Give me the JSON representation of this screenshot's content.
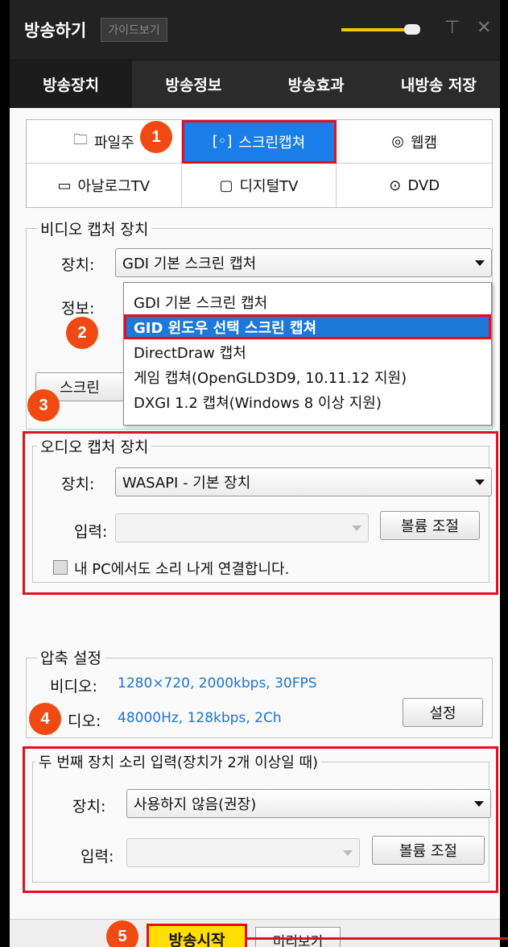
{
  "titlebar": {
    "title": "방송하기",
    "guide_label": "가이드보기",
    "pin_icon": "pin-icon",
    "close_icon": "close-icon"
  },
  "tabs": [
    {
      "label": "방송장치"
    },
    {
      "label": "방송정보"
    },
    {
      "label": "방송효과"
    },
    {
      "label": "내방송 저장"
    }
  ],
  "sources": [
    {
      "label": "파일주",
      "icon": "folder-icon",
      "selected": false
    },
    {
      "label": "스크린캡쳐",
      "icon": "screen-capture-icon",
      "selected": true
    },
    {
      "label": "웹캠",
      "icon": "webcam-icon",
      "selected": false
    },
    {
      "label": "아날로그TV",
      "icon": "analog-tv-icon",
      "selected": false
    },
    {
      "label": "디지털TV",
      "icon": "digital-tv-icon",
      "selected": false
    },
    {
      "label": "DVD",
      "icon": "dvd-icon",
      "selected": false
    }
  ],
  "video_capture": {
    "legend": "비디오 캡처 장치",
    "device_label": "장치:",
    "device_value": "GDI 기본 스크린 캡처",
    "info_label": "정보:",
    "screen_button": "스크린",
    "options": [
      "GDI 기본 스크린 캡처",
      "GID 윈도우 선택 스크린 캡쳐",
      "DirectDraw 캡처",
      "게임 캡쳐(OpenGLD3D9, 10.11.12 지원)",
      "DXGI 1.2 캡쳐(Windows 8 이상 지원)"
    ],
    "highlighted_index": 1
  },
  "audio_capture": {
    "legend": "오디오 캡처 장치",
    "device_label": "장치:",
    "device_value": "WASAPI - 기본 장치",
    "input_label": "입력:",
    "input_value": "",
    "volume_button": "볼륨 조절",
    "loopback_label": "내 PC에서도 소리 나게 연결합니다.",
    "loopback_checked": false
  },
  "compression": {
    "legend": "압축 설정",
    "video_label": "비디오:",
    "video_value": "1280×720, 2000kbps, 30FPS",
    "audio_label": "디오:",
    "audio_value": "48000Hz, 128kbps, 2Ch",
    "settings_button": "설정"
  },
  "second_audio": {
    "legend": "두 번째 장치 소리 입력(장치가 2개 이상일 때)",
    "device_label": "장치:",
    "device_value": "사용하지 않음(권장)",
    "input_label": "입력:",
    "input_value": "",
    "volume_button": "볼륨 조절"
  },
  "bottom": {
    "start_button": "방송시작",
    "preview_button": "미리보기"
  },
  "badges": [
    "1",
    "2",
    "3",
    "4",
    "5"
  ],
  "colors": {
    "accent_red": "#e01020",
    "badge_orange": "#f04a12",
    "selection_blue": "#1a7ee8",
    "start_yellow": "#ffde00"
  }
}
